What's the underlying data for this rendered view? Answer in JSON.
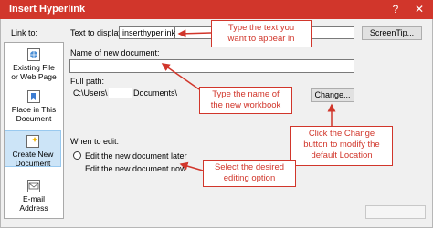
{
  "window": {
    "title": "Insert Hyperlink",
    "help_glyph": "?",
    "close_glyph": "✕"
  },
  "sidebar": {
    "heading": "Link to:",
    "items": [
      {
        "line1": "Existing File",
        "line2": "or Web Page",
        "icon": "web-page-icon",
        "selected": false
      },
      {
        "line1": "Place in This",
        "line2": "Document",
        "icon": "bookmark-document-icon",
        "selected": false
      },
      {
        "line1": "Create New",
        "line2": "Document",
        "icon": "new-document-icon",
        "selected": true
      },
      {
        "line1": "E-mail",
        "line2": "Address",
        "icon": "email-icon",
        "selected": false
      }
    ]
  },
  "text_to_display": {
    "label": "Text to display:",
    "value": "inserthyperlink"
  },
  "screentip_button": "ScreenTip...",
  "new_document": {
    "label": "Name of new document:",
    "value": ""
  },
  "full_path": {
    "label": "Full path:",
    "part1": "C:\\Users\\",
    "part2": "Documents\\"
  },
  "change_button": "Change...",
  "when_to_edit": {
    "label": "When to edit:",
    "option_later": "Edit the new document later",
    "option_now": "Edit the new document now",
    "selected": "later"
  },
  "callouts": {
    "text_to_display": {
      "line1": "Type the text you",
      "line2": "want to appear in"
    },
    "workbook_name": {
      "line1": "Type the name of",
      "line2": "the new workbook"
    },
    "change": {
      "line1": "Click the Change",
      "line2": "button to modify the",
      "line3": "default Location"
    },
    "editing": {
      "line1": "Select the desired",
      "line2": "editing option"
    }
  },
  "colors": {
    "accent": "#d1362b",
    "selected_bg": "#cce4f7"
  }
}
